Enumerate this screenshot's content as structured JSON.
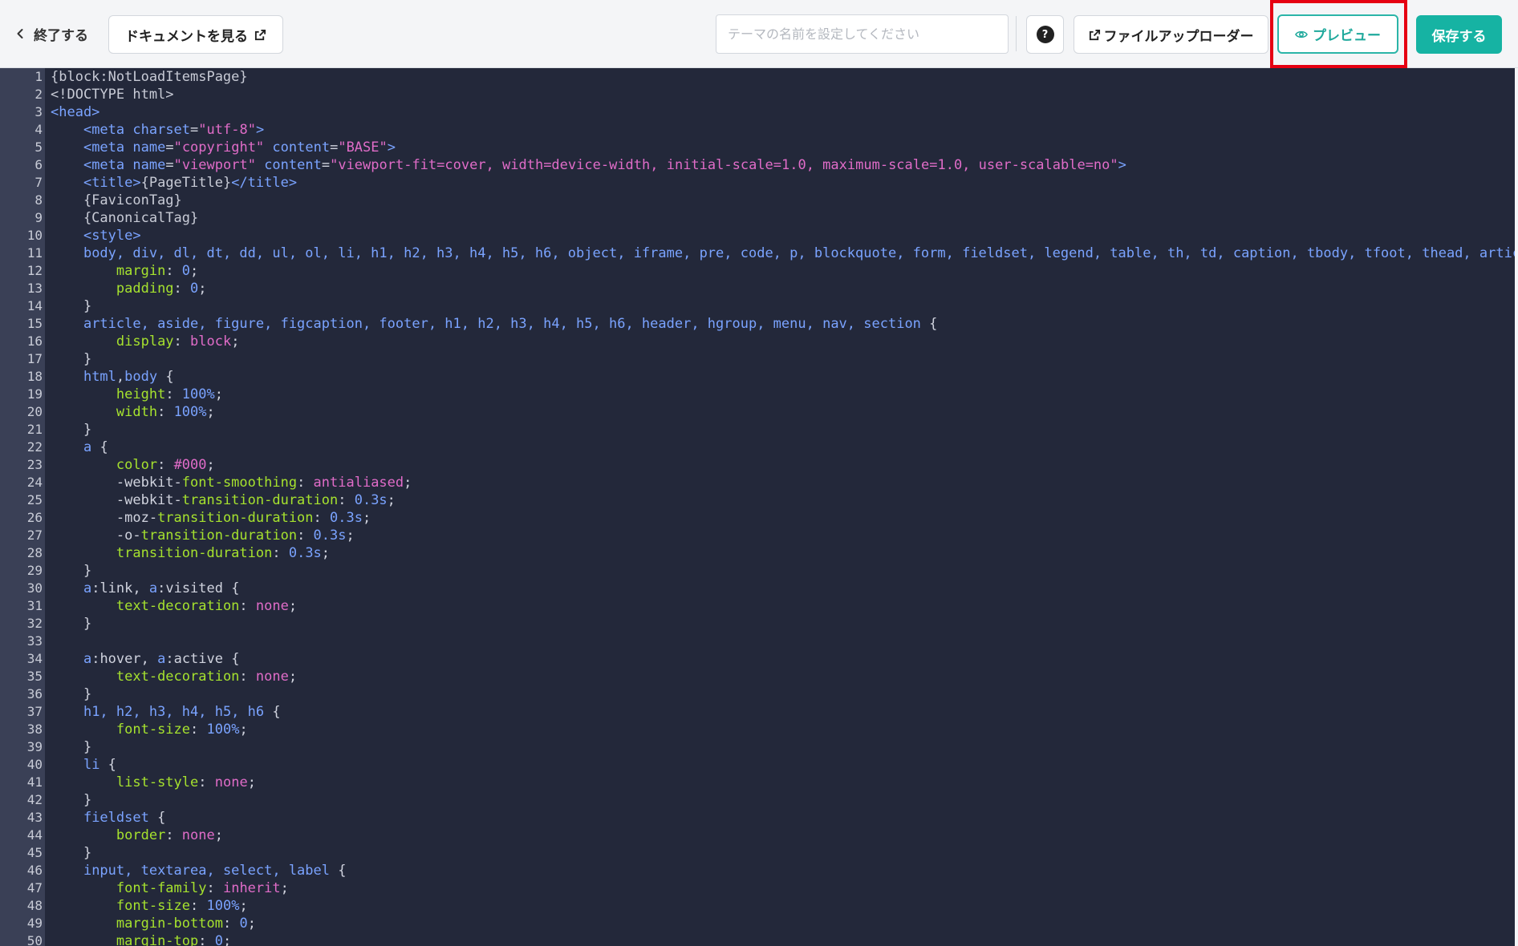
{
  "toolbar": {
    "back_label": "終了する",
    "doc_label": "ドキュメントを見る",
    "theme_placeholder": "テーマの名前を設定してください",
    "help_label": "?",
    "upload_label": "ファイルアップローダー",
    "preview_label": "プレビュー",
    "save_label": "保存する"
  },
  "colors": {
    "accent": "#16b3a3",
    "highlight": "#e60012",
    "editor_bg": "#23283a"
  },
  "icons": {
    "back": "chevron-left-icon",
    "external": "external-link-icon",
    "help": "question-circle-icon",
    "preview": "eye-icon"
  },
  "code_lines": [
    [
      [
        "pre",
        "{block:NotLoadItemsPage}"
      ]
    ],
    [
      [
        "pre",
        "<!DOCTYPE html>"
      ]
    ],
    [
      [
        "tag",
        "<head>"
      ]
    ],
    [
      [
        "plain",
        "    "
      ],
      [
        "tag",
        "<meta "
      ],
      [
        "attr",
        "charset"
      ],
      [
        "plain",
        "="
      ],
      [
        "str",
        "\"utf-8\""
      ],
      [
        "tag",
        ">"
      ]
    ],
    [
      [
        "plain",
        "    "
      ],
      [
        "tag",
        "<meta "
      ],
      [
        "attr",
        "name"
      ],
      [
        "plain",
        "="
      ],
      [
        "str",
        "\"copyright\""
      ],
      [
        "plain",
        " "
      ],
      [
        "attr",
        "content"
      ],
      [
        "plain",
        "="
      ],
      [
        "str",
        "\"BASE\""
      ],
      [
        "tag",
        ">"
      ]
    ],
    [
      [
        "plain",
        "    "
      ],
      [
        "tag",
        "<meta "
      ],
      [
        "attr",
        "name"
      ],
      [
        "plain",
        "="
      ],
      [
        "str",
        "\"viewport\""
      ],
      [
        "plain",
        " "
      ],
      [
        "attr",
        "content"
      ],
      [
        "plain",
        "="
      ],
      [
        "str",
        "\"viewport-fit=cover, width=device-width, initial-scale=1.0, maximum-scale=1.0, user-scalable=no\""
      ],
      [
        "tag",
        ">"
      ]
    ],
    [
      [
        "plain",
        "    "
      ],
      [
        "tag",
        "<title>"
      ],
      [
        "pre",
        "{PageTitle}"
      ],
      [
        "tag",
        "</title>"
      ]
    ],
    [
      [
        "pre",
        "    {FaviconTag}"
      ]
    ],
    [
      [
        "pre",
        "    {CanonicalTag}"
      ]
    ],
    [
      [
        "plain",
        "    "
      ],
      [
        "tag",
        "<style>"
      ]
    ],
    [
      [
        "plain",
        "    "
      ],
      [
        "sel",
        "body, div, dl, dt, dd, ul, ol, li, h1, h2, h3, h4, h5, h6, object, iframe, pre, code, p, blockquote, form, fieldset, legend, table, th, td, caption, tbody, tfoot, thead, artic"
      ]
    ],
    [
      [
        "plain",
        "        "
      ],
      [
        "prop",
        "margin"
      ],
      [
        "plain",
        ": "
      ],
      [
        "num",
        "0"
      ],
      [
        "plain",
        ";"
      ]
    ],
    [
      [
        "plain",
        "        "
      ],
      [
        "prop",
        "padding"
      ],
      [
        "plain",
        ": "
      ],
      [
        "num",
        "0"
      ],
      [
        "plain",
        ";"
      ]
    ],
    [
      [
        "plain",
        "    }"
      ]
    ],
    [
      [
        "plain",
        "    "
      ],
      [
        "sel",
        "article, aside, figure, figcaption, footer, h1, h2, h3, h4, h5, h6, header, hgroup, menu, nav, section"
      ],
      [
        "plain",
        " {"
      ]
    ],
    [
      [
        "plain",
        "        "
      ],
      [
        "prop",
        "display"
      ],
      [
        "plain",
        ": "
      ],
      [
        "val",
        "block"
      ],
      [
        "plain",
        ";"
      ]
    ],
    [
      [
        "plain",
        "    }"
      ]
    ],
    [
      [
        "plain",
        "    "
      ],
      [
        "sel",
        "html"
      ],
      [
        "plain",
        ","
      ],
      [
        "sel",
        "body"
      ],
      [
        "plain",
        " {"
      ]
    ],
    [
      [
        "plain",
        "        "
      ],
      [
        "prop",
        "height"
      ],
      [
        "plain",
        ": "
      ],
      [
        "num",
        "100%"
      ],
      [
        "plain",
        ";"
      ]
    ],
    [
      [
        "plain",
        "        "
      ],
      [
        "prop",
        "width"
      ],
      [
        "plain",
        ": "
      ],
      [
        "num",
        "100%"
      ],
      [
        "plain",
        ";"
      ]
    ],
    [
      [
        "plain",
        "    }"
      ]
    ],
    [
      [
        "plain",
        "    "
      ],
      [
        "sel",
        "a"
      ],
      [
        "plain",
        " {"
      ]
    ],
    [
      [
        "plain",
        "        "
      ],
      [
        "prop",
        "color"
      ],
      [
        "plain",
        ": "
      ],
      [
        "val",
        "#000"
      ],
      [
        "plain",
        ";"
      ]
    ],
    [
      [
        "plain",
        "        -webkit-"
      ],
      [
        "prop",
        "font-smoothing"
      ],
      [
        "plain",
        ": "
      ],
      [
        "val",
        "antialiased"
      ],
      [
        "plain",
        ";"
      ]
    ],
    [
      [
        "plain",
        "        -webkit-"
      ],
      [
        "prop",
        "transition-duration"
      ],
      [
        "plain",
        ": "
      ],
      [
        "num",
        "0.3s"
      ],
      [
        "plain",
        ";"
      ]
    ],
    [
      [
        "plain",
        "        -moz-"
      ],
      [
        "prop",
        "transition-duration"
      ],
      [
        "plain",
        ": "
      ],
      [
        "num",
        "0.3s"
      ],
      [
        "plain",
        ";"
      ]
    ],
    [
      [
        "plain",
        "        -o-"
      ],
      [
        "prop",
        "transition-duration"
      ],
      [
        "plain",
        ": "
      ],
      [
        "num",
        "0.3s"
      ],
      [
        "plain",
        ";"
      ]
    ],
    [
      [
        "plain",
        "        "
      ],
      [
        "prop",
        "transition-duration"
      ],
      [
        "plain",
        ": "
      ],
      [
        "num",
        "0.3s"
      ],
      [
        "plain",
        ";"
      ]
    ],
    [
      [
        "plain",
        "    }"
      ]
    ],
    [
      [
        "plain",
        "    "
      ],
      [
        "sel",
        "a"
      ],
      [
        "plain",
        ":link, "
      ],
      [
        "sel",
        "a"
      ],
      [
        "plain",
        ":visited {"
      ]
    ],
    [
      [
        "plain",
        "        "
      ],
      [
        "prop",
        "text-decoration"
      ],
      [
        "plain",
        ": "
      ],
      [
        "val",
        "none"
      ],
      [
        "plain",
        ";"
      ]
    ],
    [
      [
        "plain",
        "    }"
      ]
    ],
    [
      [
        "plain",
        ""
      ]
    ],
    [
      [
        "plain",
        "    "
      ],
      [
        "sel",
        "a"
      ],
      [
        "plain",
        ":hover, "
      ],
      [
        "sel",
        "a"
      ],
      [
        "plain",
        ":active {"
      ]
    ],
    [
      [
        "plain",
        "        "
      ],
      [
        "prop",
        "text-decoration"
      ],
      [
        "plain",
        ": "
      ],
      [
        "val",
        "none"
      ],
      [
        "plain",
        ";"
      ]
    ],
    [
      [
        "plain",
        "    }"
      ]
    ],
    [
      [
        "plain",
        "    "
      ],
      [
        "sel",
        "h1, h2, h3, h4, h5, h6"
      ],
      [
        "plain",
        " {"
      ]
    ],
    [
      [
        "plain",
        "        "
      ],
      [
        "prop",
        "font-size"
      ],
      [
        "plain",
        ": "
      ],
      [
        "num",
        "100%"
      ],
      [
        "plain",
        ";"
      ]
    ],
    [
      [
        "plain",
        "    }"
      ]
    ],
    [
      [
        "plain",
        "    "
      ],
      [
        "sel",
        "li"
      ],
      [
        "plain",
        " {"
      ]
    ],
    [
      [
        "plain",
        "        "
      ],
      [
        "prop",
        "list-style"
      ],
      [
        "plain",
        ": "
      ],
      [
        "val",
        "none"
      ],
      [
        "plain",
        ";"
      ]
    ],
    [
      [
        "plain",
        "    }"
      ]
    ],
    [
      [
        "plain",
        "    "
      ],
      [
        "sel",
        "fieldset"
      ],
      [
        "plain",
        " {"
      ]
    ],
    [
      [
        "plain",
        "        "
      ],
      [
        "prop",
        "border"
      ],
      [
        "plain",
        ": "
      ],
      [
        "val",
        "none"
      ],
      [
        "plain",
        ";"
      ]
    ],
    [
      [
        "plain",
        "    }"
      ]
    ],
    [
      [
        "plain",
        "    "
      ],
      [
        "sel",
        "input, textarea, select, label"
      ],
      [
        "plain",
        " {"
      ]
    ],
    [
      [
        "plain",
        "        "
      ],
      [
        "prop",
        "font-family"
      ],
      [
        "plain",
        ": "
      ],
      [
        "val",
        "inherit"
      ],
      [
        "plain",
        ";"
      ]
    ],
    [
      [
        "plain",
        "        "
      ],
      [
        "prop",
        "font-size"
      ],
      [
        "plain",
        ": "
      ],
      [
        "num",
        "100%"
      ],
      [
        "plain",
        ";"
      ]
    ],
    [
      [
        "plain",
        "        "
      ],
      [
        "prop",
        "margin-bottom"
      ],
      [
        "plain",
        ": "
      ],
      [
        "num",
        "0"
      ],
      [
        "plain",
        ";"
      ]
    ],
    [
      [
        "plain",
        "        "
      ],
      [
        "prop",
        "margin-top"
      ],
      [
        "plain",
        ": "
      ],
      [
        "num",
        "0"
      ],
      [
        "plain",
        ";"
      ]
    ]
  ]
}
